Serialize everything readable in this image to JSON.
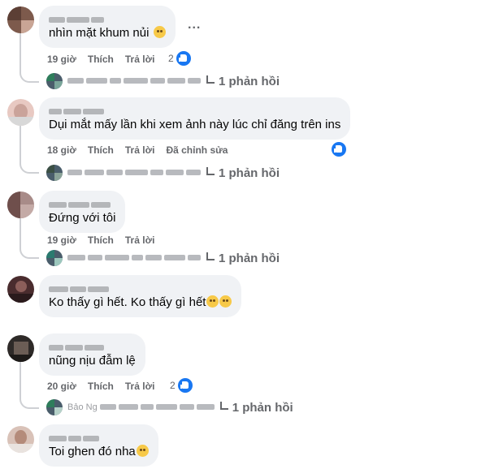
{
  "comments": [
    {
      "text": "nhìn mặt khum nủi",
      "emoji": "pleading-face",
      "time": "19 giờ",
      "like": "Thích",
      "reply": "Trả lời",
      "reaction_count": "2",
      "replies": "1 phản hồi"
    },
    {
      "text": "Dụi mắt mấy lần khi xem ảnh này lúc chỉ đăng trên ins",
      "time": "18 giờ",
      "like": "Thích",
      "reply": "Trả lời",
      "edited": "Đã chỉnh sửa",
      "replies": "1 phản hồi"
    },
    {
      "text": "Đứng với tôi",
      "time": "19 giờ",
      "like": "Thích",
      "reply": "Trả lời",
      "replies": "1 phản hồi"
    },
    {
      "text": "Ko thấy gì hết. Ko thấy gì hết",
      "emoji": "crying-face"
    },
    {
      "text": "nũng nịu đẫm lệ",
      "time": "20 giờ",
      "like": "Thích",
      "reply": "Trả lời",
      "reaction_count": "2",
      "replies": "1 phản hồi"
    },
    {
      "text": "Toi ghen đó nha",
      "emoji": "smiling-face"
    }
  ],
  "more_label": "...",
  "reply_author_preview": "Bảo Ng",
  "colors": {
    "bubble": "#f0f2f5",
    "meta": "#65676b",
    "like": "#1877f2",
    "thread": "#ced0d4"
  }
}
